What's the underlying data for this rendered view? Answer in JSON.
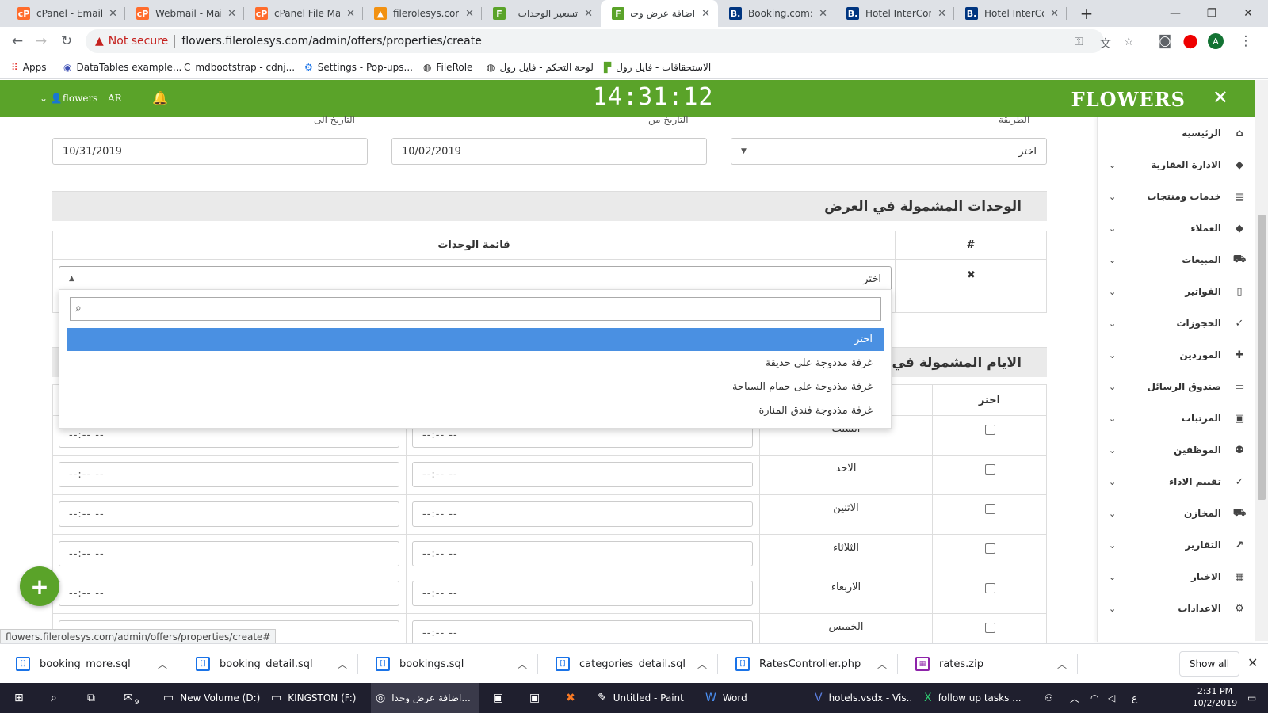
{
  "browser": {
    "tabs": [
      {
        "title": "cPanel - Email A",
        "favicon": "cpanel-icon",
        "active": false
      },
      {
        "title": "Webmail - Main",
        "favicon": "cpanel-icon",
        "active": false
      },
      {
        "title": "cPanel File Mana",
        "favicon": "cpanel-icon",
        "active": false
      },
      {
        "title": "filerolesys.com /",
        "favicon": "phpmyadmin-icon",
        "active": false
      },
      {
        "title": "تسعير الوحدات",
        "favicon": "filerole-icon",
        "active": false
      },
      {
        "title": "اضافة عرض وحدا",
        "favicon": "filerole-icon",
        "active": true
      },
      {
        "title": "Booking.com: Ho",
        "favicon": "booking-icon",
        "active": false
      },
      {
        "title": "Hotel InterConti",
        "favicon": "booking-icon",
        "active": false
      },
      {
        "title": "Hotel InterConti",
        "favicon": "booking-icon",
        "active": false
      }
    ],
    "new_tab": "+",
    "not_secure": "Not secure",
    "url": "flowers.filerolesys.com/admin/offers/properties/create",
    "profile_initial": "A",
    "bookmarks": [
      {
        "label": "Apps",
        "icon": "apps-grid-icon"
      },
      {
        "label": "DataTables example...",
        "icon": "datatables-icon"
      },
      {
        "label": "mdbootstrap - cdnj...",
        "icon": "cdnjs-icon"
      },
      {
        "label": "Settings - Pop-ups...",
        "icon": "gear-icon"
      },
      {
        "label": "FileRole",
        "icon": "globe-icon"
      },
      {
        "label": "لوحة التحكم - فايل رول",
        "icon": "globe-icon"
      },
      {
        "label": "الاستحقاقات - فايل رول",
        "icon": "filerole-icon"
      }
    ],
    "status_url": "flowers.filerolesys.com/admin/offers/properties/create#"
  },
  "header": {
    "logo": "FLOWERS",
    "clock": "14:31:12",
    "user": "flowers",
    "lang": "AR"
  },
  "sidebar": {
    "items": [
      {
        "label": "الرئيسية",
        "icon": "home-icon",
        "has_chevron": false
      },
      {
        "label": "الادارة العقارية",
        "icon": "tag-icon",
        "has_chevron": true
      },
      {
        "label": "خدمات ومنتجات",
        "icon": "file-icon",
        "has_chevron": true
      },
      {
        "label": "العملاء",
        "icon": "tag-icon",
        "has_chevron": true
      },
      {
        "label": "المبيعات",
        "icon": "cart-icon",
        "has_chevron": true
      },
      {
        "label": "الفواتير",
        "icon": "document-icon",
        "has_chevron": true
      },
      {
        "label": "الحجوزات",
        "icon": "user-check-icon",
        "has_chevron": true
      },
      {
        "label": "الموردين",
        "icon": "plus-icon",
        "has_chevron": true
      },
      {
        "label": "صندوق الرسائل",
        "icon": "inbox-icon",
        "has_chevron": true
      },
      {
        "label": "المرتبات",
        "icon": "basket-icon",
        "has_chevron": true
      },
      {
        "label": "الموظفين",
        "icon": "users-icon",
        "has_chevron": true
      },
      {
        "label": "تقييم الاداء",
        "icon": "user-check-icon",
        "has_chevron": true
      },
      {
        "label": "المخازن",
        "icon": "cart-icon",
        "has_chevron": true
      },
      {
        "label": "التقارير",
        "icon": "chart-icon",
        "has_chevron": true
      },
      {
        "label": "الاخبار",
        "icon": "newspaper-icon",
        "has_chevron": true
      },
      {
        "label": "الاعدادات",
        "icon": "gear-icon",
        "has_chevron": true
      }
    ]
  },
  "form": {
    "label_type": "الطريقة",
    "label_date_from": "التاريخ من",
    "label_date_to": "التاريخ الى",
    "type_value": "اختر",
    "date_from": "10/02/2019",
    "date_to": "10/31/2019",
    "units_section_title": "الوحدات المشمولة في العرض",
    "units_col_hash": "#",
    "units_col_list": "قائمة الوحدات",
    "unit_select_value": "اختر",
    "remove_icon": "✖",
    "days_section_title": "الايام المشمولة في العرض",
    "days_col_select": "اختر",
    "time_placeholder": "--:-- --",
    "days": [
      "السبت",
      "الاحد",
      "الاثنين",
      "الثلاثاء",
      "الاربعاء",
      "الخميس"
    ]
  },
  "dropdown": {
    "options": [
      "اختر",
      "غرفة مذدوجة على حديقة",
      "غرفة مذدوجة على حمام السباحة",
      "غرفة مذدوجة فندق المنارة"
    ],
    "selected_index": 0
  },
  "fab_label": "+",
  "downloads": {
    "files": [
      {
        "name": "booking_more.sql",
        "icon": "sql-file-icon"
      },
      {
        "name": "booking_detail.sql",
        "icon": "sql-file-icon"
      },
      {
        "name": "bookings.sql",
        "icon": "sql-file-icon"
      },
      {
        "name": "categories_detail.sql",
        "icon": "sql-file-icon"
      },
      {
        "name": "RatesController.php",
        "icon": "php-file-icon"
      },
      {
        "name": "rates.zip",
        "icon": "zip-file-icon"
      }
    ],
    "show_all": "Show all"
  },
  "taskbar": {
    "items": [
      {
        "label": "",
        "icon": "windows-icon"
      },
      {
        "label": "",
        "icon": "search-icon"
      },
      {
        "label": "",
        "icon": "task-view-icon"
      },
      {
        "label": "",
        "icon": "mail-icon"
      },
      {
        "label": "New Volume (D:)",
        "icon": "drive-icon"
      },
      {
        "label": "KINGSTON (F:)",
        "icon": "drive-icon"
      },
      {
        "label": "اضافة عرض وحدا...",
        "icon": "chrome-icon"
      },
      {
        "label": "",
        "icon": "app-icon"
      },
      {
        "label": "",
        "icon": "app-icon"
      },
      {
        "label": "",
        "icon": "xampp-icon"
      },
      {
        "label": "Untitled - Paint",
        "icon": "paint-icon"
      },
      {
        "label": "Word",
        "icon": "word-icon"
      },
      {
        "label": "hotels.vsdx - Vis...",
        "icon": "visio-icon"
      },
      {
        "label": "follow up tasks ...",
        "icon": "excel-icon"
      }
    ],
    "time": "2:31 PM",
    "date": "10/2/2019",
    "mail_badge": "9",
    "lang": "ع"
  }
}
